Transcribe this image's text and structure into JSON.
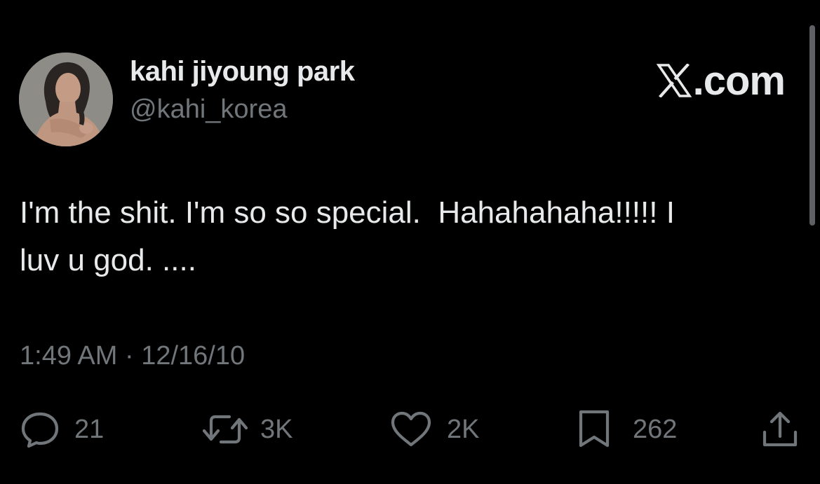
{
  "author": {
    "display_name": "kahi jiyoung park",
    "handle": "@kahi_korea",
    "avatar_icon": "profile-photo"
  },
  "brand": {
    "label": ".com",
    "icon": "x-logo-icon"
  },
  "tweet": {
    "text": "I'm the shit. I'm so so special.  Hahahahaha!!!!! I\nluv u god. ....",
    "timestamp": "1:49 AM · 12/16/10"
  },
  "actions": {
    "reply": {
      "icon": "reply-icon",
      "count": "21"
    },
    "retweet": {
      "icon": "retweet-icon",
      "count": "3K"
    },
    "like": {
      "icon": "heart-icon",
      "count": "2K"
    },
    "bookmark": {
      "icon": "bookmark-icon",
      "count": "262"
    },
    "share": {
      "icon": "share-icon"
    }
  },
  "colors": {
    "background": "#000000",
    "primary_text": "#e7e9ea",
    "secondary_text": "#71767b"
  }
}
